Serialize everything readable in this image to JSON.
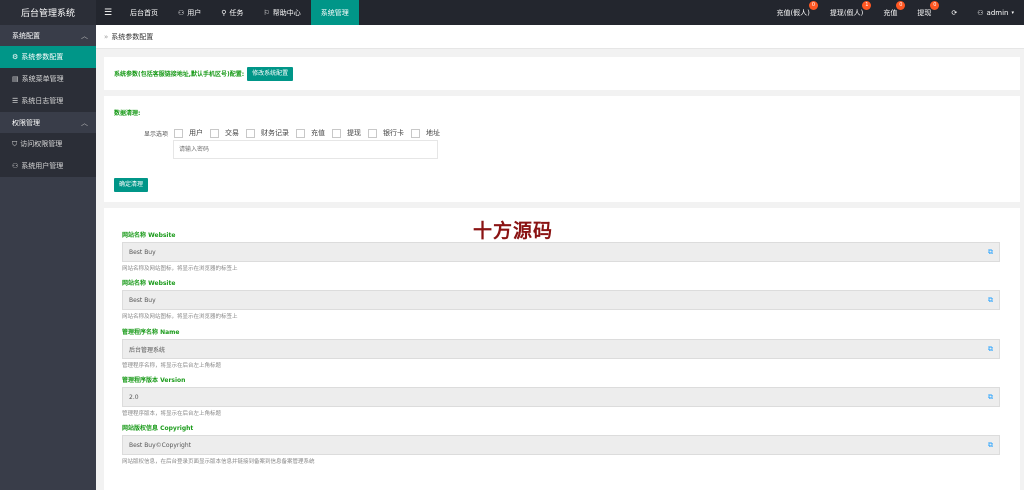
{
  "app": {
    "title": "后台管理系统",
    "menu_icon": "menu-icon"
  },
  "nav": [
    {
      "label": "后台首页",
      "icon": ""
    },
    {
      "label": "用户",
      "icon": "user-icon"
    },
    {
      "label": "任务",
      "icon": "task-icon"
    },
    {
      "label": "帮助中心",
      "icon": "flag-icon"
    },
    {
      "label": "系统管理",
      "icon": ""
    }
  ],
  "nav_right": [
    {
      "label": "充值(假人)",
      "badge": "0"
    },
    {
      "label": "提现(假人)",
      "badge": "1"
    },
    {
      "label": "充值",
      "badge": "0"
    },
    {
      "label": "提现",
      "badge": "0"
    }
  ],
  "user": {
    "name": "admin"
  },
  "sidebar": {
    "groups": [
      {
        "label": "系统配置",
        "items": [
          {
            "label": "系统参数配置",
            "icon": "gear-icon"
          },
          {
            "label": "系统菜单管理",
            "icon": "menu-table-icon"
          },
          {
            "label": "系统日志管理",
            "icon": "log-icon"
          }
        ]
      },
      {
        "label": "权限管理",
        "items": [
          {
            "label": "访问权限管理",
            "icon": "shield-icon"
          },
          {
            "label": "系统用户管理",
            "icon": "user-icon"
          }
        ]
      }
    ]
  },
  "breadcrumb": {
    "sep": "»",
    "label": "系统参数配置"
  },
  "config": {
    "label": "系统参数(包括客服链接地址,默认手机区号)配置:",
    "button": "修改系统配置"
  },
  "cleanup": {
    "title": "数据清理:",
    "filter_label": "显示选项",
    "options": [
      "用户",
      "交易",
      "财务记录",
      "充值",
      "提现",
      "银行卡",
      "地址"
    ],
    "password_placeholder": "请输入密码",
    "button": "确定清理"
  },
  "watermark": "十方源码",
  "fields": [
    {
      "label": "网站名称 Website",
      "value": "Best Buy",
      "hint": "网站名称及网站图标，将显示在浏览器的标签上"
    },
    {
      "label": "网站名称 Website",
      "value": "Best Buy",
      "hint": "网站名称及网站图标，将显示在浏览器的标签上"
    },
    {
      "label": "管理程序名称 Name",
      "value": "后台管理系统",
      "hint": "管理程序名称，将显示在后台左上角标题"
    },
    {
      "label": "管理程序版本 Version",
      "value": "2.0",
      "hint": "管理程序版本，将显示在后台左上角标题"
    },
    {
      "label": "网站版权信息 Copyright",
      "value": "Best Buy©Copyright",
      "hint": "网站版权信息，在后台登录页面显示版本信息并链接到备案到信息备案管理系统"
    }
  ],
  "colors": {
    "accent": "#009688",
    "topbar": "#23262e",
    "sidebar": "#393d49",
    "badge": "#ff5722",
    "label_green": "#1a9b1a",
    "watermark": "#8a1313"
  }
}
